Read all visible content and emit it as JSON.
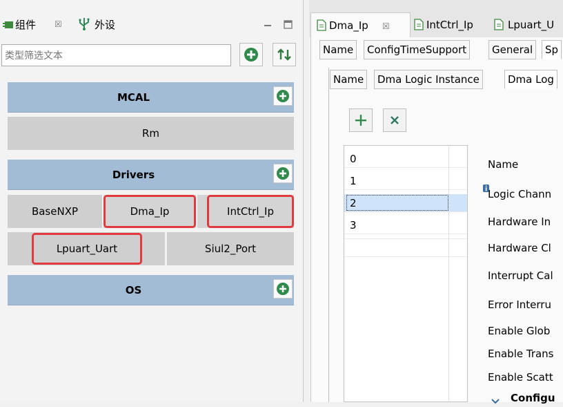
{
  "left_panel": {
    "tabs": [
      {
        "label": "组件",
        "close": "☒"
      },
      {
        "label": "外设"
      }
    ],
    "filter": {
      "placeholder": "类型筛选文本"
    },
    "categories": [
      {
        "title": "MCAL",
        "components": [
          "Rm"
        ]
      },
      {
        "title": "Drivers",
        "components": [
          "BaseNXP",
          "Dma_Ip",
          "IntCtrl_Ip",
          "Lpuart_Uart",
          "Siul2_Port"
        ]
      },
      {
        "title": "OS",
        "components": []
      }
    ]
  },
  "editor": {
    "tabs": [
      {
        "label": "Dma_Ip",
        "close": "☒"
      },
      {
        "label": "IntCtrl_Ip"
      },
      {
        "label": "Lpuart_U"
      }
    ],
    "subtabs": [
      "Name",
      "ConfigTimeSupport",
      "General",
      "Sp"
    ],
    "inner_tabs": [
      "Name",
      "Dma Logic Instance",
      "Dma Log"
    ],
    "list_items": [
      "0",
      "1",
      "2",
      "3"
    ],
    "selected_index": 2,
    "properties": [
      "Name",
      "Logic Chann",
      "Hardware In",
      "Hardware Cl",
      "Interrupt Cal",
      "Error Interru",
      "Enable Glob",
      "Enable Trans",
      "Enable Scatt"
    ],
    "section": "Configu"
  },
  "colors": {
    "category_bg": "#a3bcd6",
    "component_bg": "#cfcfcf",
    "highlight_border": "#e0393e",
    "plus_icon": "#2f8a4b"
  }
}
